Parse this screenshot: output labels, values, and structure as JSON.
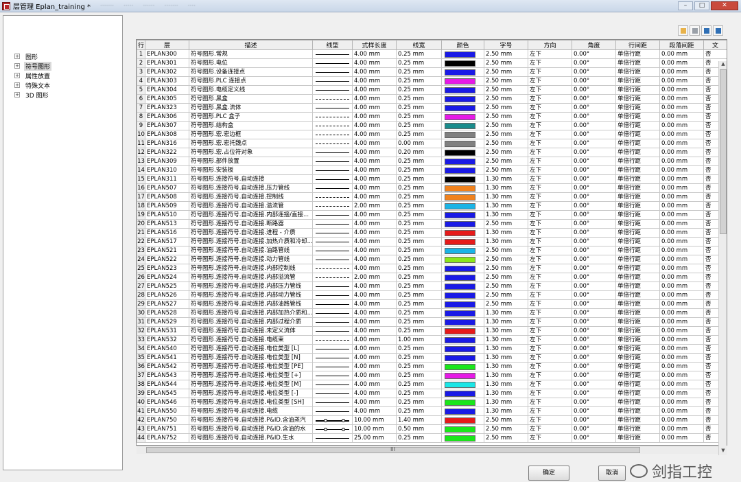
{
  "window": {
    "title": "层管理 Eplan_training *",
    "menu_blurred": [
      "·······",
      "·····",
      "······",
      "·······",
      "····"
    ],
    "minimize": "–",
    "maximize": "□",
    "close": "✕"
  },
  "tree": {
    "items": [
      {
        "label": "图形",
        "expander": "+"
      },
      {
        "label": "符号图形",
        "expander": "+"
      },
      {
        "label": "属性放置",
        "expander": "+"
      },
      {
        "label": "特殊文本",
        "expander": "+"
      },
      {
        "label": "3D 图形",
        "expander": "+"
      }
    ]
  },
  "toolbar": {
    "icons": [
      "new-layer-icon",
      "delete-layer-icon",
      "import-icon",
      "export-icon"
    ],
    "colors": [
      "#e8b24a",
      "#9aa0a8",
      "#2f6fb5",
      "#2f6fb5"
    ]
  },
  "table": {
    "headers": [
      "行",
      "层",
      "描述",
      "线型",
      "式样长度",
      "线宽",
      "颜色",
      "字号",
      "方向",
      "角度",
      "行间距",
      "段落间距",
      "文"
    ],
    "rows": [
      {
        "n": "1",
        "layer": "EPLAN300",
        "desc": "符号图形.常规",
        "lt": "solid",
        "len": "4.00 mm",
        "w": "0.25 mm",
        "color": "#1a1ae6",
        "size": "2.50 mm",
        "dir": "左下",
        "ang": "0.00°",
        "ls": "单倍行距",
        "ps": "0.00 mm",
        "t": "否"
      },
      {
        "n": "2",
        "layer": "EPLAN301",
        "desc": "符号图形.电位",
        "lt": "solid",
        "len": "4.00 mm",
        "w": "0.25 mm",
        "color": "#000000",
        "size": "2.50 mm",
        "dir": "左下",
        "ang": "0.00°",
        "ls": "单倍行距",
        "ps": "0.00 mm",
        "t": "否"
      },
      {
        "n": "3",
        "layer": "EPLAN302",
        "desc": "符号图形.设备连接点",
        "lt": "solid",
        "len": "4.00 mm",
        "w": "0.25 mm",
        "color": "#1a1ae6",
        "size": "2.50 mm",
        "dir": "左下",
        "ang": "0.00°",
        "ls": "单倍行距",
        "ps": "0.00 mm",
        "t": "否"
      },
      {
        "n": "4",
        "layer": "EPLAN303",
        "desc": "符号图形.PLC 连接点",
        "lt": "solid",
        "len": "4.00 mm",
        "w": "0.25 mm",
        "color": "#e61ae6",
        "size": "2.50 mm",
        "dir": "左下",
        "ang": "0.00°",
        "ls": "单倍行距",
        "ps": "0.00 mm",
        "t": "否"
      },
      {
        "n": "5",
        "layer": "EPLAN304",
        "desc": "符号图形.电缆定义线",
        "lt": "solid",
        "len": "4.00 mm",
        "w": "0.25 mm",
        "color": "#1a1ae6",
        "size": "2.50 mm",
        "dir": "左下",
        "ang": "0.00°",
        "ls": "单倍行距",
        "ps": "0.00 mm",
        "t": "否"
      },
      {
        "n": "6",
        "layer": "EPLAN305",
        "desc": "符号图形.黑盒",
        "lt": "dash",
        "len": "4.00 mm",
        "w": "0.25 mm",
        "color": "#1a1ae6",
        "size": "2.50 mm",
        "dir": "左下",
        "ang": "0.00°",
        "ls": "单倍行距",
        "ps": "0.00 mm",
        "t": "否"
      },
      {
        "n": "7",
        "layer": "EPLAN323",
        "desc": "符号图形.黑盒.流体",
        "lt": "solid",
        "len": "4.00 mm",
        "w": "0.25 mm",
        "color": "#1a1ae6",
        "size": "2.50 mm",
        "dir": "左下",
        "ang": "0.00°",
        "ls": "单倍行距",
        "ps": "0.00 mm",
        "t": "否"
      },
      {
        "n": "8",
        "layer": "EPLAN306",
        "desc": "符号图形.PLC 盒子",
        "lt": "dash",
        "len": "4.00 mm",
        "w": "0.25 mm",
        "color": "#e61ae6",
        "size": "2.50 mm",
        "dir": "左下",
        "ang": "0.00°",
        "ls": "单倍行距",
        "ps": "0.00 mm",
        "t": "否"
      },
      {
        "n": "9",
        "layer": "EPLAN307",
        "desc": "符号图形.结构盒",
        "lt": "dash",
        "len": "4.00 mm",
        "w": "0.25 mm",
        "color": "#1a8c8c",
        "size": "2.50 mm",
        "dir": "左下",
        "ang": "0.00°",
        "ls": "单倍行距",
        "ps": "0.00 mm",
        "t": "否"
      },
      {
        "n": "10",
        "layer": "EPLAN308",
        "desc": "符号图形.宏.宏边框",
        "lt": "dash",
        "len": "4.00 mm",
        "w": "0.25 mm",
        "color": "#808080",
        "size": "2.50 mm",
        "dir": "左下",
        "ang": "0.00°",
        "ls": "单倍行距",
        "ps": "0.00 mm",
        "t": "否"
      },
      {
        "n": "11",
        "layer": "EPLAN316",
        "desc": "符号图形.宏.宏托魏点",
        "lt": "dash",
        "len": "4.00 mm",
        "w": "0.00 mm",
        "color": "#808080",
        "size": "2.50 mm",
        "dir": "左下",
        "ang": "0.00°",
        "ls": "单倍行距",
        "ps": "0.00 mm",
        "t": "否"
      },
      {
        "n": "12",
        "layer": "EPLAN322",
        "desc": "符号图形.宏.占位符对象",
        "lt": "solid",
        "len": "4.00 mm",
        "w": "0.20 mm",
        "color": "#000000",
        "size": "2.50 mm",
        "dir": "左下",
        "ang": "0.00°",
        "ls": "单倍行距",
        "ps": "0.00 mm",
        "t": "否"
      },
      {
        "n": "13",
        "layer": "EPLAN309",
        "desc": "符号图形.部件放置",
        "lt": "solid",
        "len": "4.00 mm",
        "w": "0.25 mm",
        "color": "#1a1ae6",
        "size": "2.50 mm",
        "dir": "左下",
        "ang": "0.00°",
        "ls": "单倍行距",
        "ps": "0.00 mm",
        "t": "否"
      },
      {
        "n": "14",
        "layer": "EPLAN310",
        "desc": "符号图形.安装板",
        "lt": "solid",
        "len": "4.00 mm",
        "w": "0.25 mm",
        "color": "#1a1ae6",
        "size": "2.50 mm",
        "dir": "左下",
        "ang": "0.00°",
        "ls": "单倍行距",
        "ps": "0.00 mm",
        "t": "否"
      },
      {
        "n": "15",
        "layer": "EPLAN311",
        "desc": "符号图形.连接符号.自动连接",
        "lt": "solid",
        "len": "4.00 mm",
        "w": "0.25 mm",
        "color": "#000000",
        "size": "1.30 mm",
        "dir": "左下",
        "ang": "0.00°",
        "ls": "单倍行距",
        "ps": "0.00 mm",
        "t": "否"
      },
      {
        "n": "16",
        "layer": "EPLAN507",
        "desc": "符号图形.连接符号.自动连接.压力管线",
        "lt": "solid",
        "len": "4.00 mm",
        "w": "0.25 mm",
        "color": "#f0821e",
        "size": "1.30 mm",
        "dir": "左下",
        "ang": "0.00°",
        "ls": "单倍行距",
        "ps": "0.00 mm",
        "t": "否"
      },
      {
        "n": "17",
        "layer": "EPLAN508",
        "desc": "符号图形.连接符号.自动连接.控制线",
        "lt": "dash",
        "len": "4.00 mm",
        "w": "0.25 mm",
        "color": "#f0821e",
        "size": "1.30 mm",
        "dir": "左下",
        "ang": "0.00°",
        "ls": "单倍行距",
        "ps": "0.00 mm",
        "t": "否"
      },
      {
        "n": "18",
        "layer": "EPLAN509",
        "desc": "符号图形.连接符号.自动连接.溢流管",
        "lt": "dash",
        "len": "2.00 mm",
        "w": "0.25 mm",
        "color": "#1ab4e6",
        "size": "1.30 mm",
        "dir": "左下",
        "ang": "0.00°",
        "ls": "单倍行距",
        "ps": "0.00 mm",
        "t": "否"
      },
      {
        "n": "19",
        "layer": "EPLAN510",
        "desc": "符号图形.连接符号.自动连接.内部连接/直接...",
        "lt": "solid",
        "len": "4.00 mm",
        "w": "0.25 mm",
        "color": "#1a1ae6",
        "size": "1.30 mm",
        "dir": "左下",
        "ang": "0.00°",
        "ls": "单倍行距",
        "ps": "0.00 mm",
        "t": "否"
      },
      {
        "n": "20",
        "layer": "EPLAN513",
        "desc": "符号图形.连接符号.自动连接.断路器",
        "lt": "solid",
        "len": "4.00 mm",
        "w": "0.25 mm",
        "color": "#1a1ae6",
        "size": "2.50 mm",
        "dir": "左下",
        "ang": "0.00°",
        "ls": "单倍行距",
        "ps": "0.00 mm",
        "t": "否"
      },
      {
        "n": "21",
        "layer": "EPLAN516",
        "desc": "符号图形.连接符号.自动连接.进程 - 介质",
        "lt": "solid",
        "len": "4.00 mm",
        "w": "0.25 mm",
        "color": "#e61a1a",
        "size": "1.30 mm",
        "dir": "左下",
        "ang": "0.00°",
        "ls": "单倍行距",
        "ps": "0.00 mm",
        "t": "否"
      },
      {
        "n": "22",
        "layer": "EPLAN517",
        "desc": "符号图形.连接符号.自动连接.加热介质和冷却...",
        "lt": "solid",
        "len": "4.00 mm",
        "w": "0.25 mm",
        "color": "#e61a1a",
        "size": "1.30 mm",
        "dir": "左下",
        "ang": "0.00°",
        "ls": "单倍行距",
        "ps": "0.00 mm",
        "t": "否"
      },
      {
        "n": "23",
        "layer": "EPLAN521",
        "desc": "符号图形.连接符号.自动连接.油路管线",
        "lt": "solid",
        "len": "4.00 mm",
        "w": "0.25 mm",
        "color": "#1ab4e6",
        "size": "2.50 mm",
        "dir": "左下",
        "ang": "0.00°",
        "ls": "单倍行距",
        "ps": "0.00 mm",
        "t": "否"
      },
      {
        "n": "24",
        "layer": "EPLAN522",
        "desc": "符号图形.连接符号.自动连接.动力管线",
        "lt": "solid",
        "len": "4.00 mm",
        "w": "0.25 mm",
        "color": "#8ce61a",
        "size": "2.50 mm",
        "dir": "左下",
        "ang": "0.00°",
        "ls": "单倍行距",
        "ps": "0.00 mm",
        "t": "否"
      },
      {
        "n": "25",
        "layer": "EPLAN523",
        "desc": "符号图形.连接符号.自动连接.内部控制线",
        "lt": "dash",
        "len": "4.00 mm",
        "w": "0.25 mm",
        "color": "#1a1ae6",
        "size": "2.50 mm",
        "dir": "左下",
        "ang": "0.00°",
        "ls": "单倍行距",
        "ps": "0.00 mm",
        "t": "否"
      },
      {
        "n": "26",
        "layer": "EPLAN524",
        "desc": "符号图形.连接符号.自动连接.内部溢流管",
        "lt": "dash",
        "len": "2.00 mm",
        "w": "0.25 mm",
        "color": "#1a1ae6",
        "size": "2.50 mm",
        "dir": "左下",
        "ang": "0.00°",
        "ls": "单倍行距",
        "ps": "0.00 mm",
        "t": "否"
      },
      {
        "n": "27",
        "layer": "EPLAN525",
        "desc": "符号图形.连接符号.自动连接.内部压力管线",
        "lt": "solid",
        "len": "4.00 mm",
        "w": "0.25 mm",
        "color": "#1a1ae6",
        "size": "2.50 mm",
        "dir": "左下",
        "ang": "0.00°",
        "ls": "单倍行距",
        "ps": "0.00 mm",
        "t": "否"
      },
      {
        "n": "28",
        "layer": "EPLAN526",
        "desc": "符号图形.连接符号.自动连接.内部动力管线",
        "lt": "solid",
        "len": "4.00 mm",
        "w": "0.25 mm",
        "color": "#1a1ae6",
        "size": "2.50 mm",
        "dir": "左下",
        "ang": "0.00°",
        "ls": "单倍行距",
        "ps": "0.00 mm",
        "t": "否"
      },
      {
        "n": "29",
        "layer": "EPLAN527",
        "desc": "符号图形.连接符号.自动连接.内部油路管线",
        "lt": "solid",
        "len": "4.00 mm",
        "w": "0.25 mm",
        "color": "#1a1ae6",
        "size": "2.50 mm",
        "dir": "左下",
        "ang": "0.00°",
        "ls": "单倍行距",
        "ps": "0.00 mm",
        "t": "否"
      },
      {
        "n": "30",
        "layer": "EPLAN528",
        "desc": "符号图形.连接符号.自动连接.内部加热介质和...",
        "lt": "solid",
        "len": "4.00 mm",
        "w": "0.25 mm",
        "color": "#1a1ae6",
        "size": "1.30 mm",
        "dir": "左下",
        "ang": "0.00°",
        "ls": "单倍行距",
        "ps": "0.00 mm",
        "t": "否"
      },
      {
        "n": "31",
        "layer": "EPLAN529",
        "desc": "符号图形.连接符号.自动连接.内部过程介质",
        "lt": "solid",
        "len": "4.00 mm",
        "w": "0.25 mm",
        "color": "#1a1ae6",
        "size": "1.30 mm",
        "dir": "左下",
        "ang": "0.00°",
        "ls": "单倍行距",
        "ps": "0.00 mm",
        "t": "否"
      },
      {
        "n": "32",
        "layer": "EPLAN531",
        "desc": "符号图形.连接符号.自动连接.未定义流体",
        "lt": "solid",
        "len": "4.00 mm",
        "w": "0.25 mm",
        "color": "#e61a1a",
        "size": "1.30 mm",
        "dir": "左下",
        "ang": "0.00°",
        "ls": "单倍行距",
        "ps": "0.00 mm",
        "t": "否"
      },
      {
        "n": "33",
        "layer": "EPLAN532",
        "desc": "符号图形.连接符号.自动连接.电缆束",
        "lt": "dash",
        "len": "4.00 mm",
        "w": "1.00 mm",
        "color": "#1a1ae6",
        "size": "1.30 mm",
        "dir": "左下",
        "ang": "0.00°",
        "ls": "单倍行距",
        "ps": "0.00 mm",
        "t": "否"
      },
      {
        "n": "34",
        "layer": "EPLAN540",
        "desc": "符号图形.连接符号.自动连接.电位类型 [L]",
        "lt": "solid",
        "len": "4.00 mm",
        "w": "0.25 mm",
        "color": "#1a1ae6",
        "size": "1.30 mm",
        "dir": "左下",
        "ang": "0.00°",
        "ls": "单倍行距",
        "ps": "0.00 mm",
        "t": "否"
      },
      {
        "n": "35",
        "layer": "EPLAN541",
        "desc": "符号图形.连接符号.自动连接.电位类型 [N]",
        "lt": "solid",
        "len": "4.00 mm",
        "w": "0.25 mm",
        "color": "#1a1ae6",
        "size": "1.30 mm",
        "dir": "左下",
        "ang": "0.00°",
        "ls": "单倍行距",
        "ps": "0.00 mm",
        "t": "否"
      },
      {
        "n": "36",
        "layer": "EPLAN542",
        "desc": "符号图形.连接符号.自动连接.电位类型 [PE]",
        "lt": "solid",
        "len": "4.00 mm",
        "w": "0.25 mm",
        "color": "#1ae61a",
        "size": "1.30 mm",
        "dir": "左下",
        "ang": "0.00°",
        "ls": "单倍行距",
        "ps": "0.00 mm",
        "t": "否"
      },
      {
        "n": "37",
        "layer": "EPLAN543",
        "desc": "符号图形.连接符号.自动连接.电位类型 [+]",
        "lt": "solid",
        "len": "4.00 mm",
        "w": "0.25 mm",
        "color": "#e61ae6",
        "size": "1.30 mm",
        "dir": "左下",
        "ang": "0.00°",
        "ls": "单倍行距",
        "ps": "0.00 mm",
        "t": "否"
      },
      {
        "n": "38",
        "layer": "EPLAN544",
        "desc": "符号图形.连接符号.自动连接.电位类型 [M]",
        "lt": "solid",
        "len": "4.00 mm",
        "w": "0.25 mm",
        "color": "#1ae6e6",
        "size": "1.30 mm",
        "dir": "左下",
        "ang": "0.00°",
        "ls": "单倍行距",
        "ps": "0.00 mm",
        "t": "否"
      },
      {
        "n": "39",
        "layer": "EPLAN545",
        "desc": "符号图形.连接符号.自动连接.电位类型 [-]",
        "lt": "solid",
        "len": "4.00 mm",
        "w": "0.25 mm",
        "color": "#1a1ae6",
        "size": "1.30 mm",
        "dir": "左下",
        "ang": "0.00°",
        "ls": "单倍行距",
        "ps": "0.00 mm",
        "t": "否"
      },
      {
        "n": "40",
        "layer": "EPLAN546",
        "desc": "符号图形.连接符号.自动连接.电位类型 [SH]",
        "lt": "solid",
        "len": "4.00 mm",
        "w": "0.25 mm",
        "color": "#1ae61a",
        "size": "1.30 mm",
        "dir": "左下",
        "ang": "0.00°",
        "ls": "单倍行距",
        "ps": "0.00 mm",
        "t": "否"
      },
      {
        "n": "41",
        "layer": "EPLAN550",
        "desc": "符号图形.连接符号.自动连接.电缆",
        "lt": "solid",
        "len": "4.00 mm",
        "w": "0.25 mm",
        "color": "#1a1ae6",
        "size": "1.30 mm",
        "dir": "左下",
        "ang": "0.00°",
        "ls": "单倍行距",
        "ps": "0.00 mm",
        "t": "否"
      },
      {
        "n": "42",
        "layer": "EPLAN750",
        "desc": "符号图形.连接符号.自动连接.P&ID.含油蒸汽",
        "lt": "circle-bold",
        "len": "10.00 mm",
        "w": "1.40 mm",
        "color": "#e61a1a",
        "size": "2.50 mm",
        "dir": "左下",
        "ang": "0.00°",
        "ls": "单倍行距",
        "ps": "0.00 mm",
        "t": "否"
      },
      {
        "n": "43",
        "layer": "EPLAN751",
        "desc": "符号图形.连接符号.自动连接.P&ID.含油的水",
        "lt": "circle",
        "len": "10.00 mm",
        "w": "0.50 mm",
        "color": "#1ae61a",
        "size": "2.50 mm",
        "dir": "左下",
        "ang": "0.00°",
        "ls": "单倍行距",
        "ps": "0.00 mm",
        "t": "否"
      },
      {
        "n": "44",
        "layer": "EPLAN752",
        "desc": "符号图形.连接符号.自动连接.P&ID.生水",
        "lt": "solid",
        "len": "25.00 mm",
        "w": "0.25 mm",
        "color": "#1ae61a",
        "size": "2.50 mm",
        "dir": "左下",
        "ang": "0.00°",
        "ls": "单倍行距",
        "ps": "0.00 mm",
        "t": "否"
      }
    ]
  },
  "scroll": {
    "h_grip": "III",
    "up": "▲",
    "down": "▼"
  },
  "buttons": {
    "ok": "确定",
    "cancel": "取消"
  },
  "watermark": "剑指工控"
}
